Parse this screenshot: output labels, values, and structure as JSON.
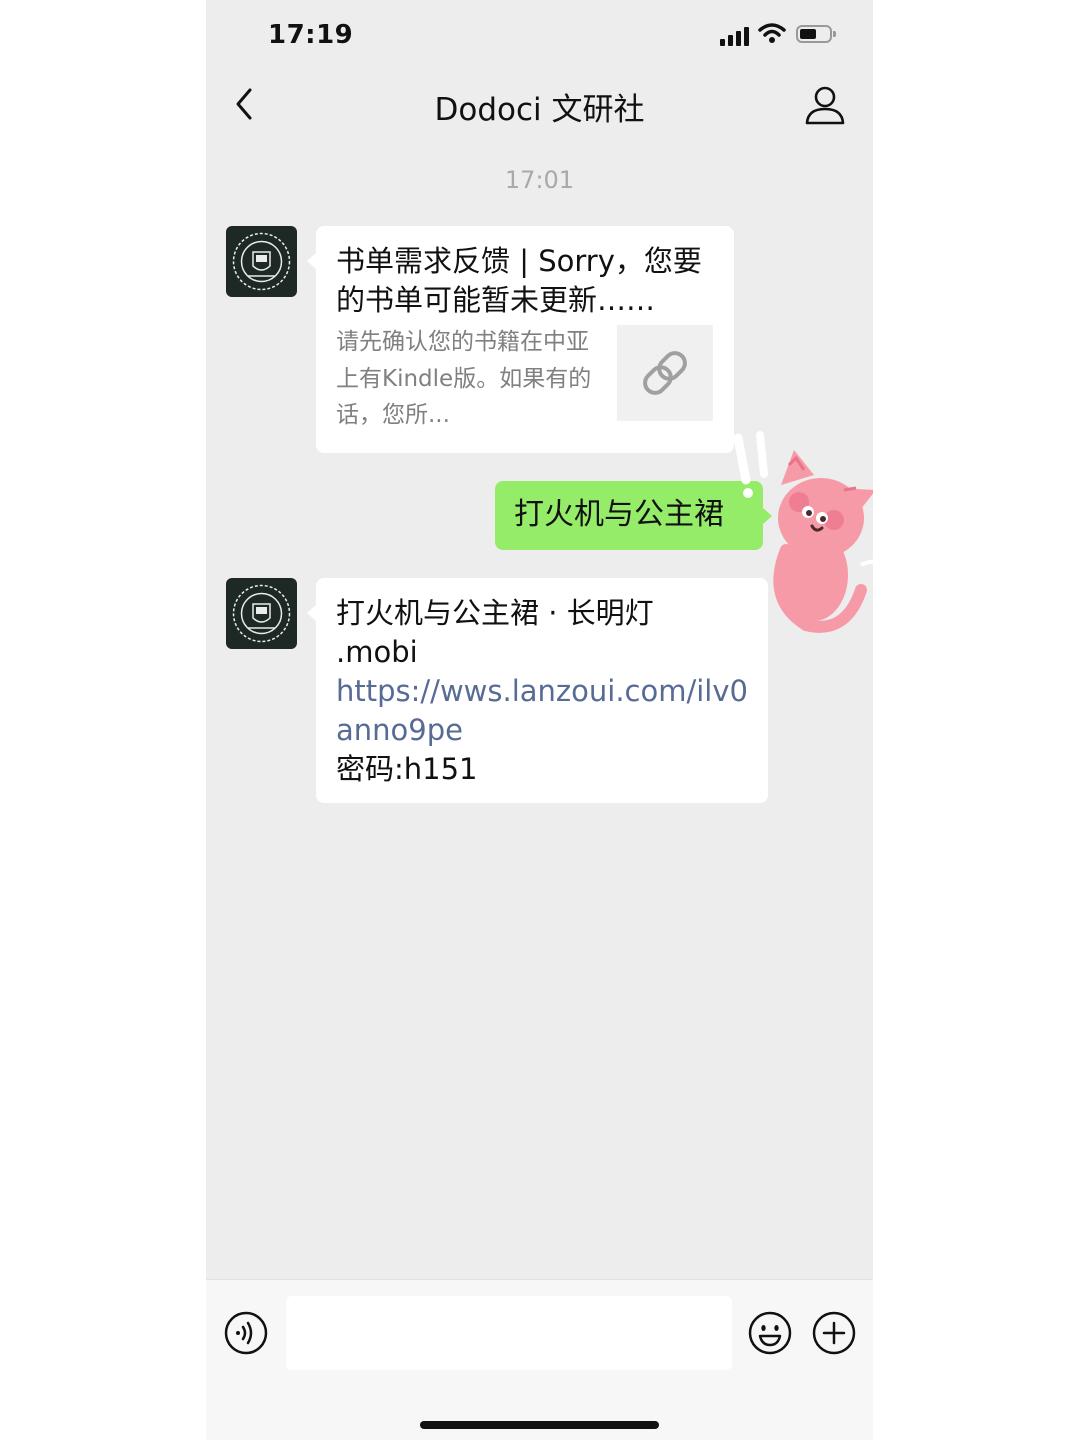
{
  "status_bar": {
    "time": "17:19"
  },
  "nav": {
    "title": "Dodoci 文研社",
    "back_icon": "chevron-left-icon",
    "profile_icon": "person-icon"
  },
  "chat": {
    "timestamp": "17:01",
    "messages": [
      {
        "type": "link-card",
        "direction": "incoming",
        "title": "书单需求反馈 | Sorry，您要的书单可能暂未更新……",
        "description": "请先确认您的书籍在中亚上有Kindle版。如果有的话，您所...",
        "thumb_icon": "link-icon"
      },
      {
        "type": "text",
        "direction": "outgoing",
        "text": "打火机与公主裙"
      },
      {
        "type": "text",
        "direction": "incoming",
        "line1": "打火机与公主裙 · 长明灯",
        "line2": ".mobi",
        "link": "https://wws.lanzoui.com/ilv0anno9pe",
        "line3": "密码:h151"
      }
    ]
  },
  "input_bar": {
    "voice_icon": "voice-icon",
    "text_value": "",
    "emoji_icon": "emoji-icon",
    "plus_icon": "plus-icon"
  },
  "colors": {
    "background": "#ededed",
    "outgoing_bubble": "#95ec69",
    "incoming_bubble": "#ffffff",
    "link": "#576b95",
    "avatar": "#1e2926",
    "sticker": "#f59aa6"
  }
}
